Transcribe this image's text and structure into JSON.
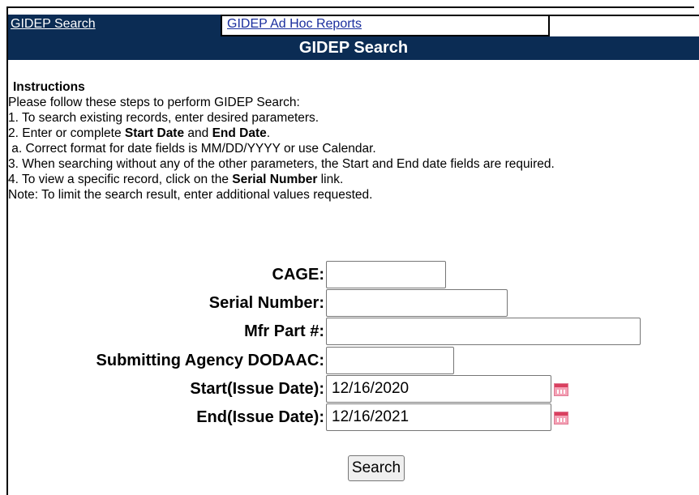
{
  "tabs": {
    "search": "GIDEP Search",
    "adhoc": "GIDEP Ad Hoc Reports"
  },
  "page_title": "GIDEP Search",
  "instructions": {
    "heading": "Instructions",
    "intro": "Please follow these steps to perform GIDEP Search:",
    "step1": "1. To search existing records, enter desired parameters.",
    "step2_prefix": "2. Enter or complete ",
    "step2_start": "Start Date",
    "step2_and": " and ",
    "step2_end": "End Date",
    "step2_suffix": ".",
    "step2a": " a. Correct format for date fields is MM/DD/YYYY or use Calendar.",
    "step3": "3. When searching without any of the other parameters, the Start and End date fields are required.",
    "step4_prefix": "4. To view a specific record, click on the ",
    "step4_bold": "Serial Number",
    "step4_suffix": " link.",
    "note": "Note: To limit the search result, enter additional values requested."
  },
  "form": {
    "cage_label": "CAGE:",
    "cage_value": "",
    "serial_label": "Serial Number:",
    "serial_value": "",
    "mfr_label": "Mfr Part #:",
    "mfr_value": "",
    "dodaac_label": "Submitting Agency DODAAC:",
    "dodaac_value": "",
    "start_label": "Start(Issue Date):",
    "start_value": "12/16/2020",
    "end_label": "End(Issue Date):",
    "end_value": "12/16/2021",
    "search_button": "Search"
  },
  "colors": {
    "header_bg": "#0b2c54",
    "link_color": "#1a2e9e",
    "calendar_icon": "#f4a2b6"
  }
}
